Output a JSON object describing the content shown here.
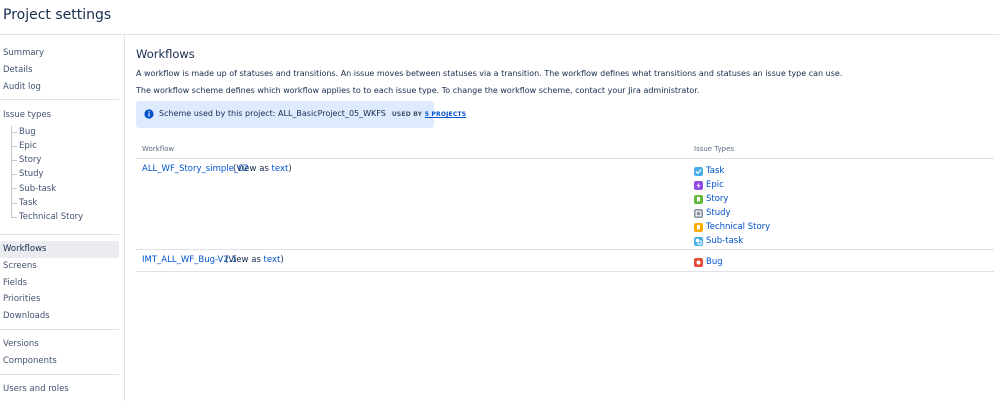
{
  "header": {
    "title": "Project settings"
  },
  "sidebar": {
    "group1": [
      "Summary",
      "Details",
      "Audit log"
    ],
    "issue_types_heading": "Issue types",
    "issue_types": [
      "Bug",
      "Epic",
      "Story",
      "Study",
      "Sub-task",
      "Task",
      "Technical Story"
    ],
    "group2": [
      "Workflows",
      "Screens",
      "Fields",
      "Priorities",
      "Downloads"
    ],
    "selected": "Workflows",
    "group3": [
      "Versions",
      "Components"
    ],
    "group4": [
      "Users and roles"
    ]
  },
  "main": {
    "title": "Workflows",
    "desc1": "A workflow is made up of statuses and transitions. An issue moves between statuses via a transition. The workflow defines what transitions and statuses an issue type can use.",
    "desc2": "The workflow scheme defines which workflow applies to to each issue type. To change the workflow scheme, contact your Jira administrator.",
    "info": {
      "text": "Scheme used by this project: ALL_BasicProject_05_WKFS",
      "used_by": "USED BY",
      "used_link": "5 PROJECTS"
    },
    "table": {
      "col_workflow": "Workflow",
      "col_issue_types": "Issue Types",
      "rows": [
        {
          "name": "ALL_WF_Story_simple_02",
          "view_open": "(View as ",
          "view_link": "text",
          "view_close": ")",
          "issue_types": [
            {
              "label": "Task",
              "icon": "task-icon",
              "color": "#4bade8"
            },
            {
              "label": "Epic",
              "icon": "epic-icon",
              "color": "#904ee2"
            },
            {
              "label": "Story",
              "icon": "story-icon",
              "color": "#63ba3c"
            },
            {
              "label": "Study",
              "icon": "study-icon",
              "color": "#8993a4"
            },
            {
              "label": "Technical Story",
              "icon": "technical-story-icon",
              "color": "#ffab00"
            },
            {
              "label": "Sub-task",
              "icon": "subtask-icon",
              "color": "#4bade8"
            }
          ]
        },
        {
          "name": "IMT_ALL_WF_Bug-V2.1",
          "view_open": "(View as ",
          "view_link": "text",
          "view_close": ")",
          "issue_types": [
            {
              "label": "Bug",
              "icon": "bug-icon",
              "color": "#e5493a"
            }
          ]
        }
      ]
    }
  }
}
